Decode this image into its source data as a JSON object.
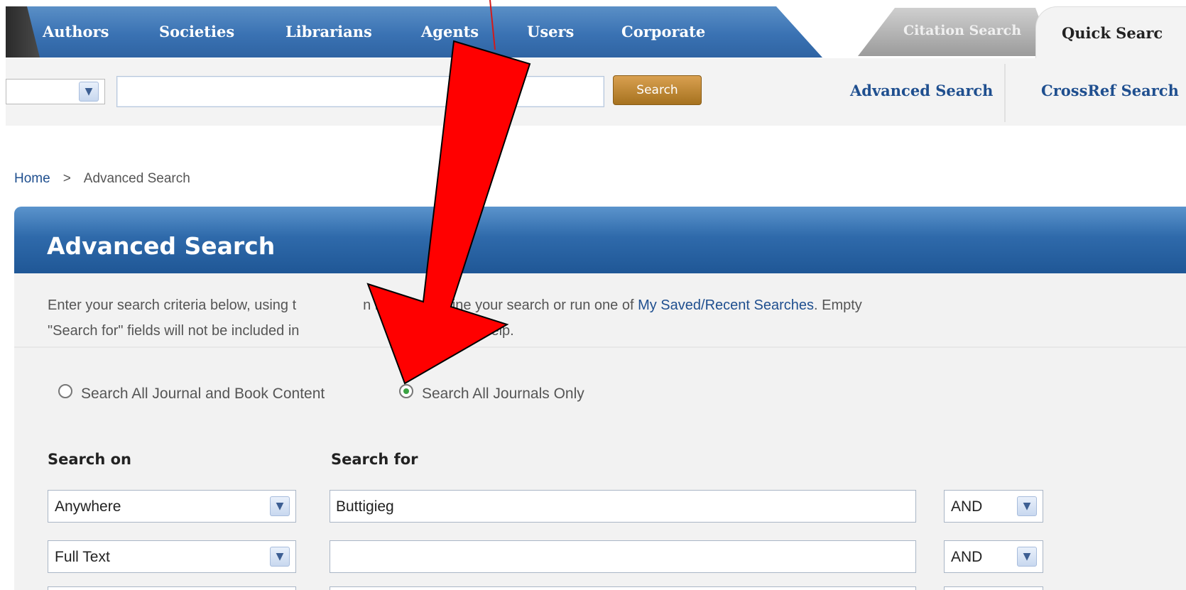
{
  "nav": {
    "items": [
      "Authors",
      "Societies",
      "Librarians",
      "Agents",
      "Users",
      "Corporate"
    ],
    "tabs": {
      "citation": "Citation Search",
      "quick": "Quick Searc"
    }
  },
  "quick_search": {
    "button": "Search",
    "advanced_link": "Advanced Search",
    "crossref_link": "CrossRef Search"
  },
  "breadcrumb": {
    "home": "Home",
    "separator": ">",
    "current": "Advanced Search"
  },
  "advanced": {
    "title": "Advanced Search",
    "desc": {
      "line1_part1": "Enter your search criteria below, using t",
      "line1_part2": "n boxes to define your search or run one of",
      "saved_link": "My Saved/Recent Searches",
      "line1_end": ". Empty",
      "line2_part1": "\"Search for\" fields will not be included in",
      "line2_part2": "lick",
      "help_link": "here",
      "line2_end": "for help."
    },
    "radios": [
      {
        "label": "Search All Journal and Book Content",
        "checked": false
      },
      {
        "label": "Search All Journals Only",
        "checked": true
      }
    ],
    "columns": {
      "search_on": "Search on",
      "search_for": "Search for"
    },
    "rows": [
      {
        "search_on": "Anywhere",
        "search_for": "Buttigieg",
        "op": "AND"
      },
      {
        "search_on": "Full Text",
        "search_for": "",
        "op": "AND"
      }
    ]
  },
  "colors": {
    "nav_blue": "#3a72b3",
    "link_blue": "#1f4f8f",
    "arrow_red": "#ff0000",
    "search_button": "#c18a36"
  },
  "icons": {
    "dropdown": "chevron-down-icon",
    "annotation": "red-arrow-icon"
  }
}
